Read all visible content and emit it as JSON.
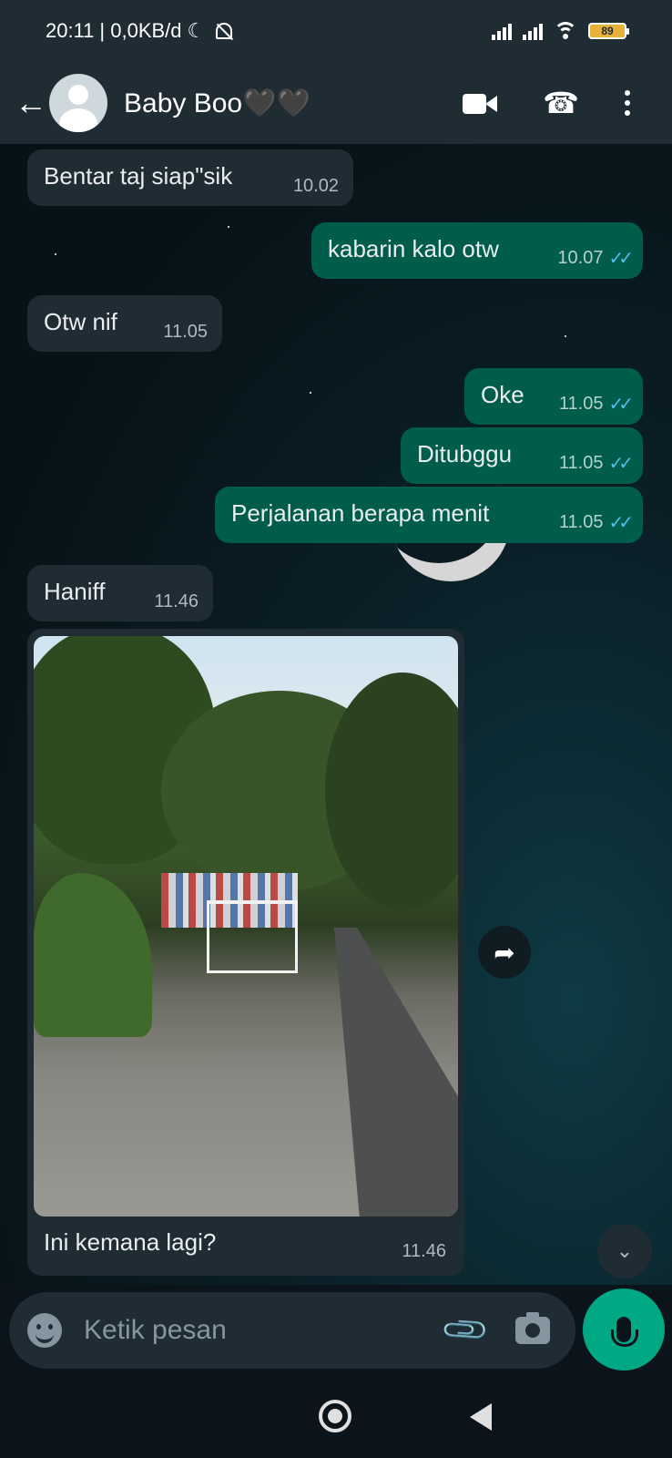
{
  "status_bar": {
    "time": "20:11",
    "network_speed": "| 0,0KB/d",
    "moon_icon": "☾",
    "battery_level": "89"
  },
  "header": {
    "back_icon": "←",
    "contact_name": "Baby Boo🖤🖤",
    "call_icon": "☎"
  },
  "messages": [
    {
      "text": "Bentar taj siap\"sik",
      "time": "10.02",
      "direction": "in"
    },
    {
      "text": "kabarin kalo otw",
      "time": "10.07",
      "direction": "out",
      "read": true
    },
    {
      "text": "Otw nif",
      "time": "11.05",
      "direction": "in"
    },
    {
      "text": "Oke",
      "time": "11.05",
      "direction": "out",
      "read": true
    },
    {
      "text": "Ditubggu",
      "time": "11.05",
      "direction": "out",
      "read": true
    },
    {
      "text": "Perjalanan berapa menit",
      "time": "11.05",
      "direction": "out",
      "read": true
    },
    {
      "text": "Haniff",
      "time": "11.46",
      "direction": "in"
    }
  ],
  "image_message": {
    "caption": "Ini kemana lagi?",
    "time": "11.46"
  },
  "ticks": "✓✓",
  "forward_icon": "➦",
  "scroll_icon": "⌄",
  "input": {
    "placeholder": "Ketik pesan",
    "clip_icon": "📎"
  },
  "colors": {
    "incoming_bubble": "#202c33",
    "outgoing_bubble": "#005c4b",
    "read_ticks": "#53bdeb",
    "mic_button": "#00a884"
  }
}
